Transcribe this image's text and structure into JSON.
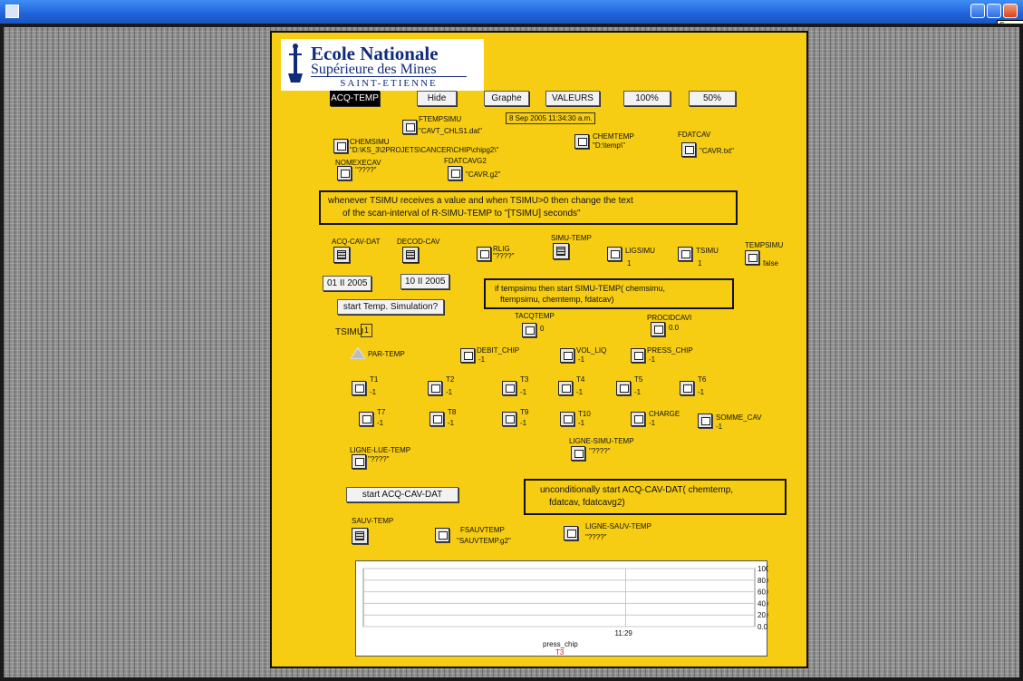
{
  "window": {
    "tooltip": "Ferme"
  },
  "logo": {
    "line1": "Ecole Nationale",
    "line2": "Supérieure des Mines",
    "line3": "SAINT-ETIENNE"
  },
  "toolbar": [
    "ACQ-TEMP",
    "Hide",
    "Graphe",
    "VALEURS",
    "100%",
    "50%"
  ],
  "timestamp": "8 Sep 2005  11:34:30 a.m.",
  "vars": {
    "ftempsimu": {
      "label": "FTEMPSIMU",
      "value": "\"CAVT_CHLS1.dat\""
    },
    "chemsimu": {
      "label": "CHEMSIMU",
      "value": "\"D:\\KS_3\\2PROJETS\\CANCER\\CHIP\\chipg2\\\""
    },
    "chemtemp": {
      "label": "CHEMTEMP",
      "value": "\"D:\\temp\\\""
    },
    "fdatcav": {
      "label": "FDATCAV",
      "value": "\"CAVR.txt\""
    },
    "nomexecav": {
      "label": "NOMEXECAV",
      "value": "\"????\""
    },
    "fdatcavg2": {
      "label": "FDATCAVG2",
      "value": "\"CAVR.g2\""
    }
  },
  "rule1": {
    "line1": "whenever TSIMU receives a value and when TSIMU>0 then change the text",
    "line2": "of the scan-interval of R-SIMU-TEMP to \"[TSIMU] seconds\""
  },
  "procs": {
    "acq": "ACQ-CAV-DAT",
    "decod": "DECOD-CAV",
    "rlig": {
      "label": "RLIG",
      "value": "\"????\""
    },
    "simu": "SIMU-TEMP",
    "ligsimu": {
      "label": "LIGSIMU",
      "value": "1"
    },
    "tsimu": {
      "label": "TSIMU",
      "value": "1"
    },
    "tempsimu": {
      "label": "TEMPSIMU",
      "value": "false"
    }
  },
  "dates": [
    "01 II 2005",
    "10 II 2005"
  ],
  "rule2": {
    "line1": "if tempsimu then start SIMU-TEMP( chemsimu,",
    "line2": "ftempsimu, chemtemp, fdatcav)"
  },
  "start_sim_label": "start Temp. Simulation?",
  "tsimu_field": {
    "label": "TSIMU",
    "value": "1"
  },
  "tacqtemp": {
    "label": "TACQTEMP",
    "value": "0"
  },
  "procidcavi": {
    "label": "PROCIDCAVI",
    "value": "0.0"
  },
  "partemp": "PAR-TEMP",
  "debit": {
    "label": "DEBIT_CHIP",
    "value": "-1"
  },
  "volliq": {
    "label": "VOL_LIQ",
    "value": "-1"
  },
  "presschip": {
    "label": "PRESS_CHIP",
    "value": "-1"
  },
  "row1": [
    {
      "label": "T1",
      "value": "-1"
    },
    {
      "label": "T2",
      "value": "-1"
    },
    {
      "label": "T3",
      "value": "-1"
    },
    {
      "label": "T4",
      "value": "-1"
    },
    {
      "label": "T5",
      "value": "-1"
    },
    {
      "label": "T6",
      "value": "-1"
    }
  ],
  "row2": [
    {
      "label": "T7",
      "value": "-1"
    },
    {
      "label": "T8",
      "value": "-1"
    },
    {
      "label": "T9",
      "value": "-1"
    },
    {
      "label": "T10",
      "value": "-1"
    },
    {
      "label": "CHARGE",
      "value": "-1"
    },
    {
      "label": "SOMME_CAV",
      "value": "-1"
    }
  ],
  "lignelue": {
    "label": "LIGNE-LUE-TEMP",
    "value": "\"????\""
  },
  "lignesimu": {
    "label": "LIGNE-SIMU-TEMP",
    "value": "\"????\""
  },
  "start_acq_label": "start ACQ-CAV-DAT",
  "rule3": {
    "line1": "unconditionally start ACQ-CAV-DAT( chemtemp,",
    "line2": "fdatcav, fdatcavg2)"
  },
  "sauvtemp": "SAUV-TEMP",
  "fsauvtemp": {
    "label": "FSAUVTEMP",
    "value": "\"SAUVTEMP.g2\""
  },
  "lignesauv": {
    "label": "LIGNE-SAUV-TEMP",
    "value": "\"????\""
  },
  "chart_data": {
    "type": "line",
    "y_ticks": [
      "100.0",
      "80.0",
      "60.0",
      "40.0",
      "20.0",
      "0.0"
    ],
    "ylim": [
      0,
      100
    ],
    "x_ticks": [
      "11:29"
    ],
    "series": [
      {
        "name": "press_chip",
        "values": []
      }
    ],
    "legend_sub": "T3",
    "legend_sub_color": "#e01010"
  }
}
